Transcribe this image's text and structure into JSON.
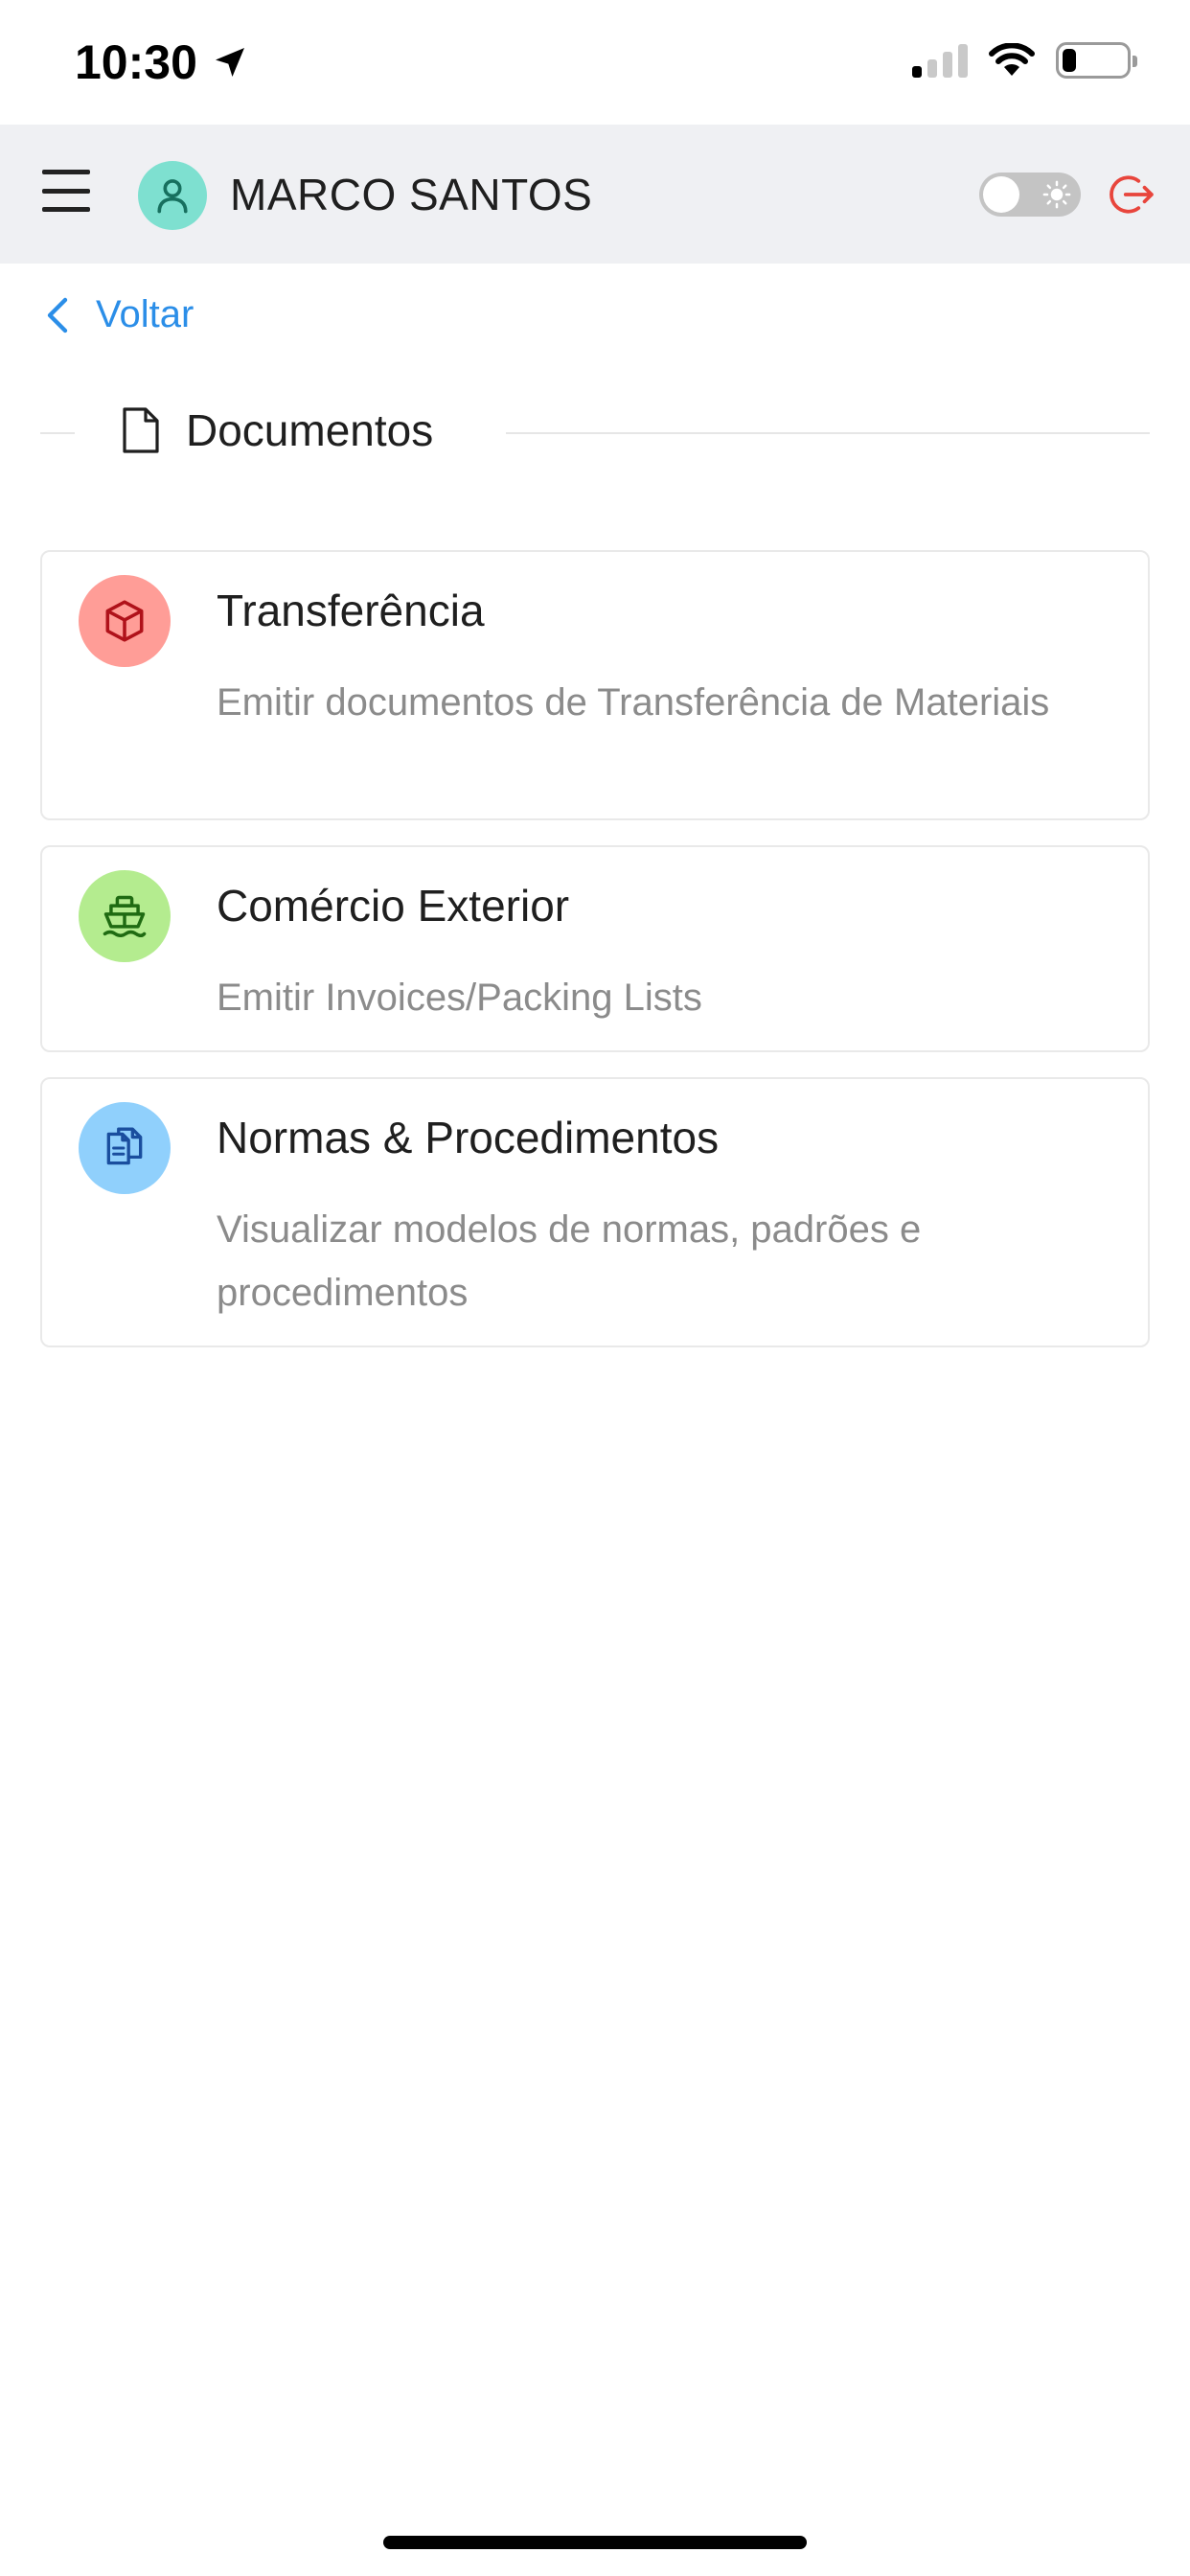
{
  "status_bar": {
    "time": "10:30"
  },
  "header": {
    "user_name": "MARCO SANTOS"
  },
  "nav": {
    "back_label": "Voltar"
  },
  "section": {
    "title": "Documentos"
  },
  "cards": [
    {
      "title": "Transferência",
      "description": "Emitir documentos de Transferência de Materiais",
      "icon": "package-icon",
      "icon_bg": "#ff9d97",
      "icon_color": "#b0121a"
    },
    {
      "title": "Comércio Exterior",
      "description": "Emitir Invoices/Packing Lists",
      "icon": "ship-icon",
      "icon_bg": "#b4ec8f",
      "icon_color": "#1f6b12"
    },
    {
      "title": "Normas & Procedimentos",
      "description": "Visualizar modelos de normas, padrões e procedimentos",
      "icon": "documents-icon",
      "icon_bg": "#90d0fc",
      "icon_color": "#1a4e9e"
    }
  ],
  "colors": {
    "accent": "#2b8ee8",
    "logout": "#e8453c",
    "header_bg": "#eff0f3",
    "avatar_bg": "#7ee0d0"
  }
}
